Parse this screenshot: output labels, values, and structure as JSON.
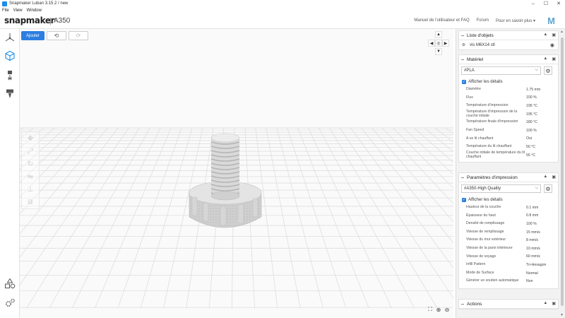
{
  "window": {
    "title": "Snapmaker Luban 3.15.2 / new",
    "controls": [
      "–",
      "☐",
      "✕"
    ]
  },
  "menu": [
    "File",
    "View",
    "Window"
  ],
  "header": {
    "brand": "snapmaker",
    "machine": "A350",
    "links": [
      "Manuel de l'utilisateur et FAQ",
      "Forum",
      "Pour en savoir plus ▾"
    ],
    "right_logo": "M"
  },
  "toolbar": {
    "add_label": "Ajouter",
    "undo_icon": "undo-icon",
    "redo_icon": "redo-icon"
  },
  "object_list": {
    "title": "Liste d'objets",
    "items": [
      {
        "name": "vis M6X14 stl"
      }
    ]
  },
  "material": {
    "title": "Matériel",
    "selected": "#PLA",
    "show_details": "Afficher les détails",
    "params": [
      {
        "label": "Diamètre",
        "value": "1.75 mm"
      },
      {
        "label": "Flux",
        "value": "100 %"
      },
      {
        "label": "Température d'impression",
        "value": "195 °C"
      },
      {
        "label": "Température d'impression de la couche initiale",
        "value": "195 °C"
      },
      {
        "label": "Température finale d'impression",
        "value": "180 °C"
      },
      {
        "label": "Fan Speed",
        "value": "100 %"
      },
      {
        "label": "A un lit chauffant",
        "value": "Oui"
      },
      {
        "label": "Température du lit chauffant",
        "value": "50 °C"
      },
      {
        "label": "Couche initiale de température du lit chauffant",
        "value": "55 °C"
      }
    ]
  },
  "print_settings": {
    "title": "Paramètres d'impression",
    "selected": "#A350-High Quality",
    "show_details": "Afficher les détails",
    "params": [
      {
        "label": "Hauteur de la couche",
        "value": "0.1 mm"
      },
      {
        "label": "Épaisseur du haut",
        "value": "0.8 mm"
      },
      {
        "label": "Densité de remplissage",
        "value": "100 %"
      },
      {
        "label": "Vitesse de remplissage",
        "value": "15 mm/s"
      },
      {
        "label": "Vitesse du mur extérieur",
        "value": "8 mm/s"
      },
      {
        "label": "Vitesse de la paroi intérieure",
        "value": "10 mm/s"
      },
      {
        "label": "Vitesse de voyage",
        "value": "60 mm/s"
      },
      {
        "label": "Infill Pattern",
        "value": "Tri-Hexagon"
      },
      {
        "label": "Mode de Surface",
        "value": "Normal"
      },
      {
        "label": "Générer un soutien automatique",
        "value": "Non"
      }
    ]
  },
  "actions": {
    "title": "Actions"
  },
  "icons": {
    "accent": "#2c7ee0",
    "brand_blue": "#1c8de8"
  }
}
